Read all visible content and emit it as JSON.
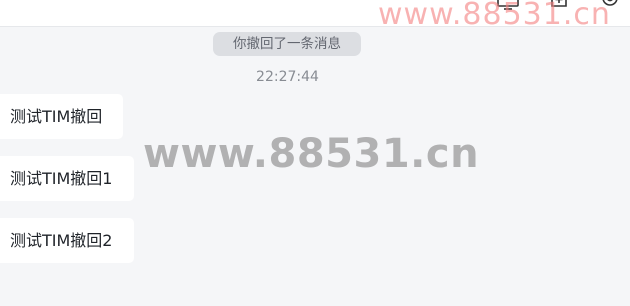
{
  "header": {
    "icons": [
      "monitor-icon",
      "add-file-icon",
      "gear-icon"
    ]
  },
  "chat": {
    "recall_notice": "你撤回了一条消息",
    "timestamp": "22:27:44",
    "messages": [
      {
        "text": "测试TIM撤回"
      },
      {
        "text": "测试TIM撤回1"
      },
      {
        "text": "测试TIM撤回2"
      }
    ]
  },
  "watermark": {
    "center": "www.88531.cn",
    "corner": "www.88531.cn"
  }
}
